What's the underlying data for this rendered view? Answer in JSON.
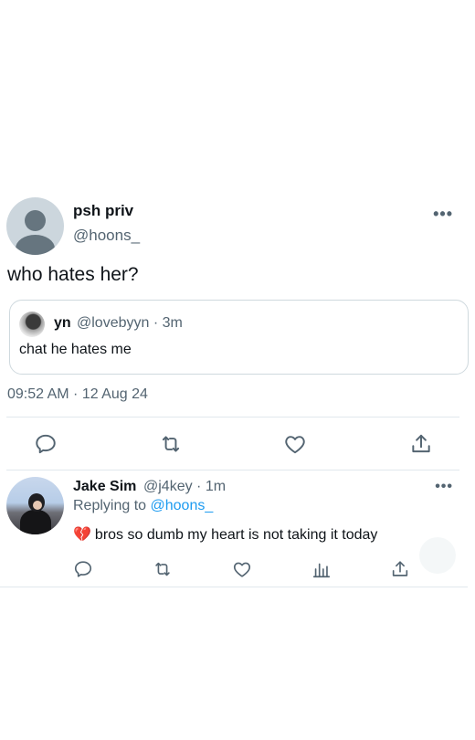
{
  "tweet": {
    "display_name": "psh priv",
    "handle": "@hoons_",
    "more_label": "•••",
    "text": "who hates her?",
    "timestamp": "09:52 AM · 12 Aug 24",
    "quote": {
      "display_name": "yn",
      "meta": "@lovebyyn · 3m",
      "text": "chat he hates me"
    },
    "actions": {
      "reply_icon": "reply-icon",
      "retweet_icon": "retweet-icon",
      "like_icon": "heart-icon",
      "share_icon": "share-icon"
    }
  },
  "reply": {
    "display_name": "Jake Sim",
    "meta": "@j4key · 1m",
    "more_label": "•••",
    "replying_prefix": "Replying to",
    "replying_to": "@hoons_",
    "emoji": "💔",
    "text": "bros so dumb my heart is not taking it today",
    "actions": {
      "reply_icon": "reply-icon",
      "retweet_icon": "retweet-icon",
      "like_icon": "heart-icon",
      "views_icon": "analytics-icon",
      "share_icon": "share-icon"
    }
  },
  "colors": {
    "text_primary": "#0f1419",
    "text_secondary": "#536471",
    "link": "#1d9bf0",
    "divider": "#e1e8ed"
  }
}
